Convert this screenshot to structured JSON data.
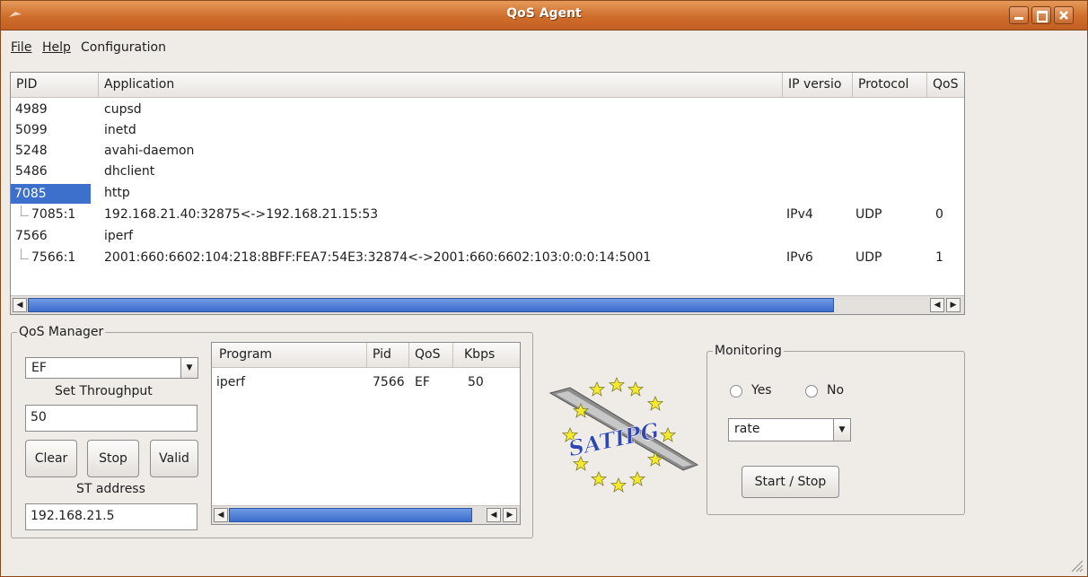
{
  "window": {
    "title": "QoS Agent"
  },
  "menu": {
    "file": "File",
    "help": "Help",
    "configuration": "Configuration"
  },
  "process_table": {
    "columns": [
      "PID",
      "Application",
      "IP versio",
      "Protocol",
      "QoS"
    ],
    "rows": [
      {
        "pid": "4989",
        "app": "cupsd"
      },
      {
        "pid": "5099",
        "app": "inetd"
      },
      {
        "pid": "5248",
        "app": "avahi-daemon"
      },
      {
        "pid": "5486",
        "app": "dhclient"
      },
      {
        "pid": "7085",
        "app": "http",
        "selected": true
      },
      {
        "pid": "7085:1",
        "app": "192.168.21.40:32875<->192.168.21.15:53",
        "ipver": "IPv4",
        "proto": "UDP",
        "qos": "0",
        "child": true
      },
      {
        "pid": "7566",
        "app": "iperf"
      },
      {
        "pid": "7566:1",
        "app": "2001:660:6602:104:218:8BFF:FEA7:54E3:32874<->2001:660:6602:103:0:0:0:14:5001",
        "ipver": "IPv6",
        "proto": "UDP",
        "qos": "1",
        "child": true
      }
    ]
  },
  "qos_manager": {
    "title": "QoS Manager",
    "class_select": "EF",
    "throughput_label": "Set Throughput",
    "throughput_value": "50",
    "clear_label": "Clear",
    "stop_label": "Stop",
    "valid_label": "Valid",
    "st_label": "ST address",
    "st_value": "192.168.21.5",
    "table": {
      "columns": [
        "Program",
        "Pid",
        "QoS",
        "Kbps"
      ],
      "rows": [
        {
          "program": "iperf",
          "pid": "7566",
          "qos": "EF",
          "kbps": "50"
        }
      ]
    }
  },
  "logo": {
    "text": "SATIPG"
  },
  "monitoring": {
    "title": "Monitoring",
    "yes_label": "Yes",
    "no_label": "No",
    "mode_select": "rate",
    "start_stop_label": "Start / Stop"
  },
  "colors": {
    "titlebar": "#cf6d2c",
    "selection": "#3d6fcc",
    "window_bg": "#efebe7"
  }
}
